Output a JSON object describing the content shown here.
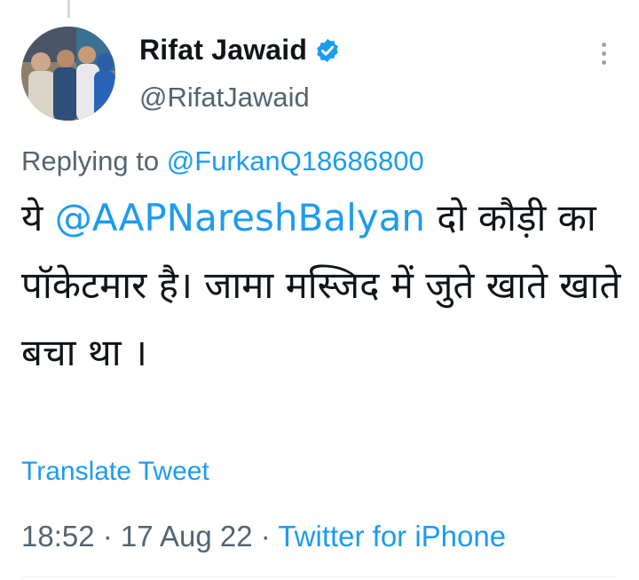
{
  "tweet": {
    "display_name": "Rifat Jawaid",
    "handle": "@RifatJawaid",
    "verified_icon": "verified-badge-icon",
    "more_icon": "more-options-icon",
    "reply_prefix": "Replying to ",
    "reply_to": "@FurkanQ18686800",
    "text_before": "ये ",
    "text_mention": "@AAPNareshBalyan",
    "text_after": " दो कौड़ी का पॉकेटमार है। जामा मस्जिद में जुते खाते खाते बचा था ।",
    "translate_label": "Translate Tweet",
    "time": "18:52",
    "date": "17 Aug 22",
    "separator": " · ",
    "source": "Twitter for iPhone"
  },
  "colors": {
    "accent": "#1d9bf0",
    "secondary_text": "#536471",
    "primary_text": "#0f1419"
  }
}
